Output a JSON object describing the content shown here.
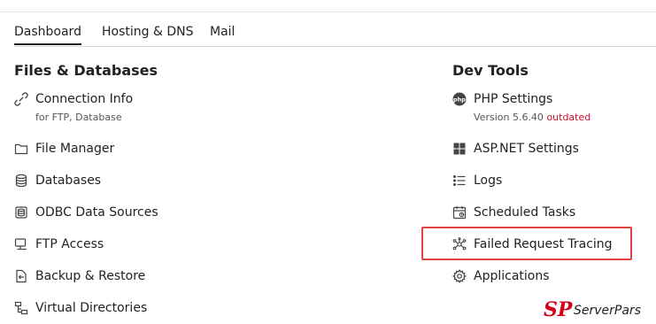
{
  "tabs": [
    {
      "label": "Dashboard",
      "active": true
    },
    {
      "label": "Hosting & DNS",
      "active": false
    },
    {
      "label": "Mail",
      "active": false
    }
  ],
  "left_section": {
    "title": "Files & Databases",
    "items": [
      {
        "label": "Connection Info",
        "sub": "for FTP, Database",
        "icon": "connection-icon"
      },
      {
        "label": "File Manager",
        "icon": "folder-icon"
      },
      {
        "label": "Databases",
        "icon": "database-icon"
      },
      {
        "label": "ODBC Data Sources",
        "icon": "odbc-icon"
      },
      {
        "label": "FTP Access",
        "icon": "ftp-icon"
      },
      {
        "label": "Backup & Restore",
        "icon": "backup-icon"
      },
      {
        "label": "Virtual Directories",
        "icon": "virtual-directories-icon"
      }
    ]
  },
  "right_section": {
    "title": "Dev Tools",
    "items": [
      {
        "label": "PHP Settings",
        "icon": "php-icon",
        "sub_prefix": "Version 5.6.40",
        "sub_status": "outdated"
      },
      {
        "label": "ASP.NET Settings",
        "icon": "aspnet-icon"
      },
      {
        "label": "Logs",
        "icon": "logs-icon"
      },
      {
        "label": "Scheduled Tasks",
        "icon": "calendar-icon"
      },
      {
        "label": "Failed Request Tracing",
        "icon": "tracing-icon",
        "highlighted": true
      },
      {
        "label": "Applications",
        "icon": "gear-icon"
      }
    ]
  },
  "watermark": {
    "mark": "SP",
    "text": "ServerPars"
  },
  "colors": {
    "outdated": "#c8102e",
    "highlight": "#e04141",
    "text": "#222222"
  }
}
